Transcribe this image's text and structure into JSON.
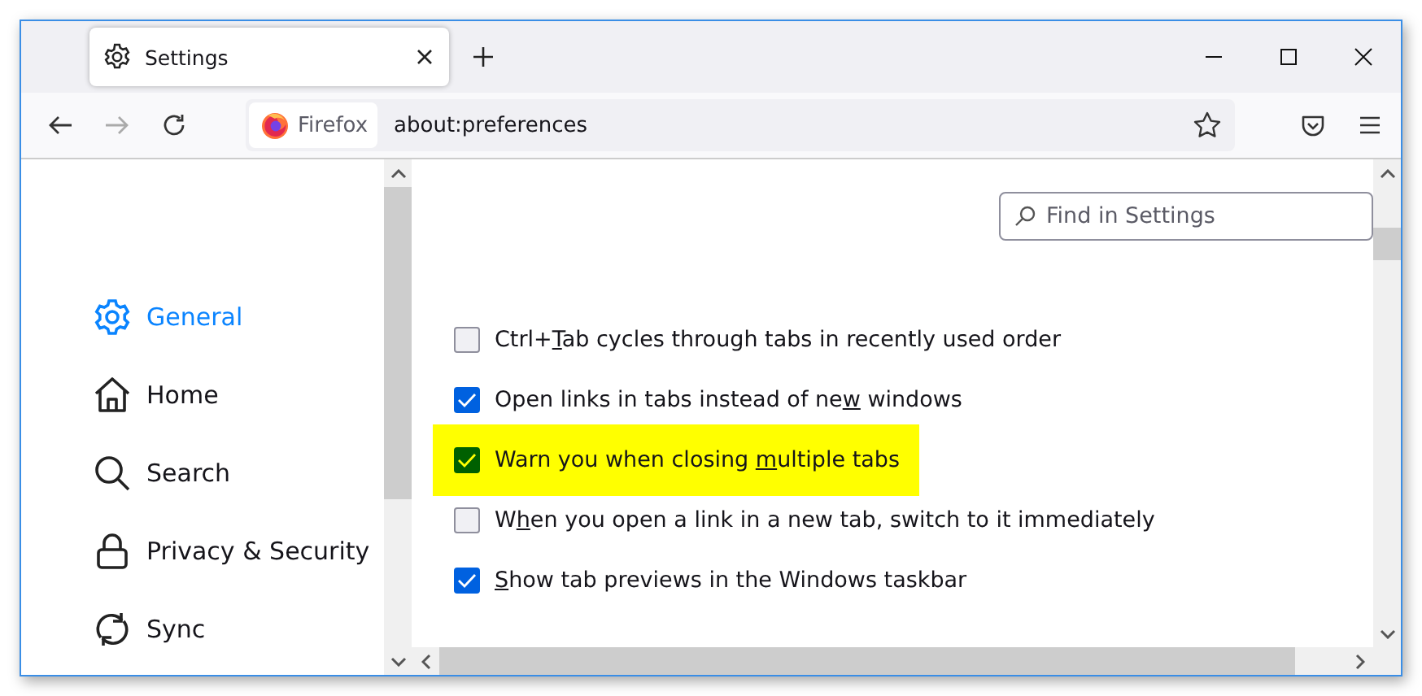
{
  "tabs": [
    {
      "title": "Settings",
      "selected": true
    }
  ],
  "toolbar": {
    "identity_label": "Firefox",
    "url": "about:preferences"
  },
  "sidebar": {
    "items": [
      {
        "label": "General",
        "selected": true
      },
      {
        "label": "Home",
        "selected": false
      },
      {
        "label": "Search",
        "selected": false
      },
      {
        "label": "Privacy & Security",
        "selected": false
      },
      {
        "label": "Sync",
        "selected": false
      }
    ]
  },
  "search": {
    "placeholder": "Find in Settings"
  },
  "options": [
    {
      "text_before": "Ctrl+",
      "access_key": "T",
      "text_after": "ab cycles through tabs in recently used order",
      "checked": false,
      "highlighted": false
    },
    {
      "text_before": "Open links in tabs instead of ne",
      "access_key": "w",
      "text_after": " windows",
      "checked": true,
      "highlighted": false
    },
    {
      "text_before": "Warn you when closing ",
      "access_key": "m",
      "text_after": "ultiple tabs",
      "checked": true,
      "highlighted": true
    },
    {
      "text_before": "W",
      "access_key": "h",
      "text_after": "en you open a link in a new tab, switch to it immediately",
      "checked": false,
      "highlighted": false
    },
    {
      "access_key": "S",
      "text_after": "how tab previews in the Windows taskbar",
      "checked": true,
      "highlighted": false
    }
  ]
}
